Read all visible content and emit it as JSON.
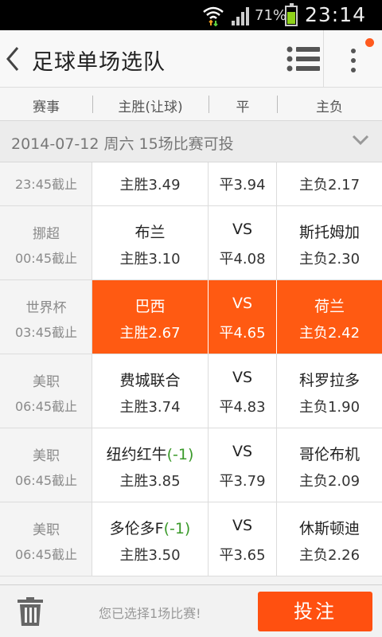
{
  "status": {
    "battery_pct": "71%",
    "time": "23:14"
  },
  "header": {
    "title": "足球单场选队"
  },
  "columns": {
    "league": "赛事",
    "home": "主胜(让球)",
    "draw": "平",
    "away": "主负"
  },
  "date_bar": {
    "text": "2014-07-12 周六   15场比赛可投"
  },
  "matches": [
    {
      "league": "",
      "deadline": "23:45截止",
      "home": "",
      "handicap": "",
      "home_odd": "主胜3.49",
      "vs": "",
      "draw_odd": "平3.94",
      "away": "",
      "away_odd": "主负2.17"
    },
    {
      "league": "挪超",
      "deadline": "00:45截止",
      "home": "布兰",
      "handicap": "",
      "home_odd": "主胜3.10",
      "vs": "VS",
      "draw_odd": "平4.08",
      "away": "斯托姆加",
      "away_odd": "主负2.30"
    },
    {
      "league": "世界杯",
      "deadline": "03:45截止",
      "home": "巴西",
      "handicap": "",
      "home_odd": "主胜2.67",
      "vs": "VS",
      "draw_odd": "平4.65",
      "away": "荷兰",
      "away_odd": "主负2.42"
    },
    {
      "league": "美职",
      "deadline": "06:45截止",
      "home": "费城联合",
      "handicap": "",
      "home_odd": "主胜3.74",
      "vs": "VS",
      "draw_odd": "平4.83",
      "away": "科罗拉多",
      "away_odd": "主负1.90"
    },
    {
      "league": "美职",
      "deadline": "06:45截止",
      "home": "纽约红牛",
      "handicap": "(-1)",
      "home_odd": "主胜3.85",
      "vs": "VS",
      "draw_odd": "平3.79",
      "away": "哥伦布机",
      "away_odd": "主负2.09"
    },
    {
      "league": "美职",
      "deadline": "06:45截止",
      "home": "多伦多F",
      "handicap": "(-1)",
      "home_odd": "主胜3.50",
      "vs": "VS",
      "draw_odd": "平3.65",
      "away": "休斯顿迪",
      "away_odd": "主负2.26"
    }
  ],
  "footer": {
    "selection_msg": "您已选择1场比赛!",
    "bet_label": "投注"
  },
  "colors": {
    "accent": "#ff5a12",
    "handicap": "#3a9a2a"
  },
  "icons": [
    "wifi-icon",
    "signal-icon",
    "battery-icon",
    "back-arrow-icon",
    "list-menu-icon",
    "more-vertical-icon",
    "chevron-down-icon",
    "trash-icon"
  ]
}
